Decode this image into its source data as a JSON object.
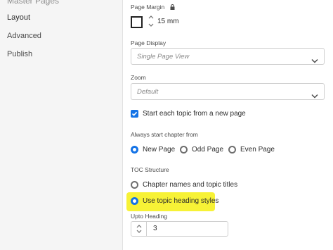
{
  "sidebar": {
    "cut_item": "Master Pages",
    "items": [
      {
        "label": "Layout",
        "active": true
      },
      {
        "label": "Advanced",
        "active": false
      },
      {
        "label": "Publish",
        "active": false
      }
    ]
  },
  "page_margin": {
    "label": "Page Margin",
    "value": "15 mm"
  },
  "page_display": {
    "label": "Page Display",
    "value": "Single Page View"
  },
  "zoom": {
    "label": "Zoom",
    "value": "Default"
  },
  "start_new_page": {
    "label": "Start each topic from a new page",
    "checked": true
  },
  "chapter_start": {
    "label": "Always start chapter from",
    "options": [
      "New Page",
      "Odd Page",
      "Even Page"
    ],
    "selected": "New Page"
  },
  "toc_structure": {
    "label": "TOC Structure",
    "options": [
      "Chapter names and topic titles",
      "Use topic heading styles"
    ],
    "selected": "Use topic heading styles"
  },
  "upto_heading": {
    "label": "Upto Heading",
    "value": "3"
  },
  "colors": {
    "accent": "#1473e6",
    "highlight": "#f7f236"
  }
}
